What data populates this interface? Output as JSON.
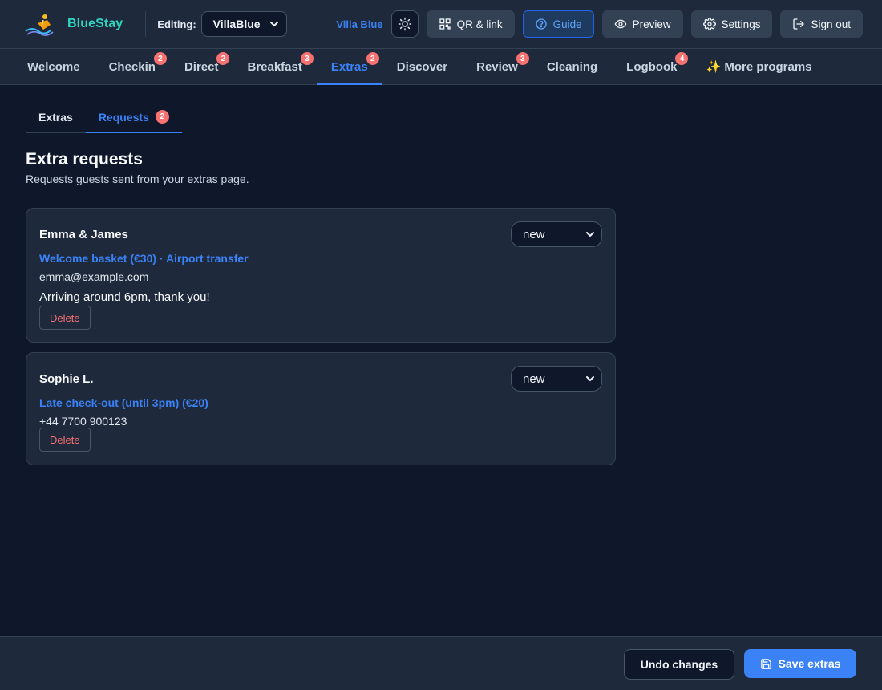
{
  "header": {
    "brand_name": "BlueStay",
    "editing_label": "Editing:",
    "property_select": {
      "value": "VillaBlue"
    },
    "villa_name": "Villa Blue",
    "buttons": {
      "qr": "QR & link",
      "guide": "Guide",
      "preview": "Preview",
      "settings": "Settings",
      "sign_out": "Sign out"
    }
  },
  "nav": {
    "items": [
      {
        "label": "Welcome",
        "badge": ""
      },
      {
        "label": "Checkin",
        "badge": "2"
      },
      {
        "label": "Direct",
        "badge": "2"
      },
      {
        "label": "Breakfast",
        "badge": "3"
      },
      {
        "label": "Extras",
        "badge": "2"
      },
      {
        "label": "Discover",
        "badge": ""
      },
      {
        "label": "Review",
        "badge": "3"
      },
      {
        "label": "Cleaning",
        "badge": ""
      },
      {
        "label": "Logbook",
        "badge": "4"
      },
      {
        "label": "✨ More programs",
        "badge": ""
      }
    ]
  },
  "subtabs": {
    "extras": "Extras",
    "requests": "Requests",
    "requests_badge": "2"
  },
  "page": {
    "title": "Extra requests",
    "subtitle": "Requests guests sent from your extras page."
  },
  "requests": [
    {
      "name": "Emma & James",
      "status": "new",
      "items": "Welcome basket (€30) · Airport transfer",
      "contact": "emma@example.com",
      "note": "Arriving around 6pm, thank you!",
      "delete_label": "Delete"
    },
    {
      "name": "Sophie L.",
      "status": "new",
      "items": "Late check-out (until 3pm) (€20)",
      "contact": "+44 7700 900123",
      "delete_label": "Delete"
    }
  ],
  "footer": {
    "undo_label": "Undo changes",
    "save_label": "Save extras"
  },
  "colors": {
    "accent": "#3b82f6",
    "badge": "#f87171",
    "background": "#0f172a",
    "surface": "#1e293b",
    "brand": "#2dd4bf"
  }
}
